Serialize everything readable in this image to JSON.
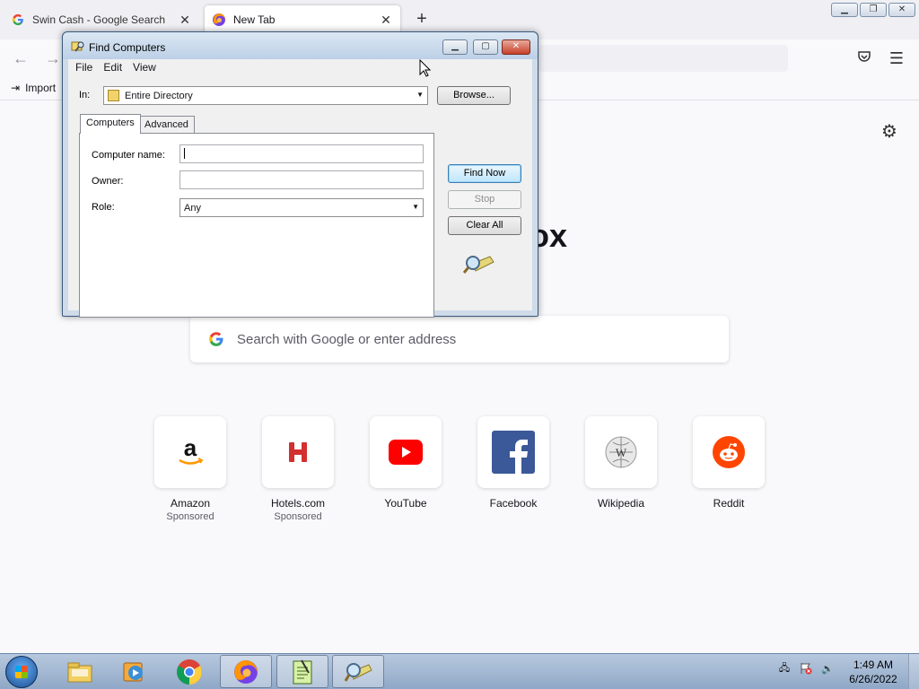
{
  "browser": {
    "tabs": [
      {
        "title": "Swin Cash - Google Search",
        "favicon": "google-icon",
        "active": false
      },
      {
        "title": "New Tab",
        "favicon": "firefox-icon",
        "active": true
      }
    ],
    "bookmarks": {
      "import_label": "Import"
    },
    "brand_fragment": "ox",
    "search": {
      "placeholder": "Search with Google or enter address"
    },
    "shortcuts": [
      {
        "name": "Amazon",
        "sponsored": "Sponsored",
        "icon": "amazon-icon"
      },
      {
        "name": "Hotels.com",
        "sponsored": "Sponsored",
        "icon": "hotels-icon"
      },
      {
        "name": "YouTube",
        "sponsored": "",
        "icon": "youtube-icon"
      },
      {
        "name": "Facebook",
        "sponsored": "",
        "icon": "facebook-icon"
      },
      {
        "name": "Wikipedia",
        "sponsored": "",
        "icon": "wikipedia-icon"
      },
      {
        "name": "Reddit",
        "sponsored": "",
        "icon": "reddit-icon"
      }
    ]
  },
  "dialog": {
    "title": "Find Computers",
    "menu": [
      "File",
      "Edit",
      "View"
    ],
    "in_label": "In:",
    "in_value": "Entire Directory",
    "browse_label": "Browse...",
    "tabs": [
      "Computers",
      "Advanced"
    ],
    "computer_name_label": "Computer name:",
    "computer_name_value": "",
    "owner_label": "Owner:",
    "owner_value": "",
    "role_label": "Role:",
    "role_value": "Any",
    "find_now_label": "Find Now",
    "stop_label": "Stop",
    "clear_all_label": "Clear All"
  },
  "taskbar": {
    "apps": [
      "windows-explorer-icon",
      "media-player-icon",
      "chrome-icon",
      "firefox-icon",
      "notepad-icon",
      "find-computers-icon"
    ],
    "time": "1:49 AM",
    "date": "6/26/2022"
  },
  "colors": {
    "accent_blue": "#3c7fb1",
    "youtube_red": "#ff0000",
    "facebook_blue": "#3b5998",
    "reddit_orange": "#ff4500",
    "hotels_red": "#d32f2f"
  }
}
